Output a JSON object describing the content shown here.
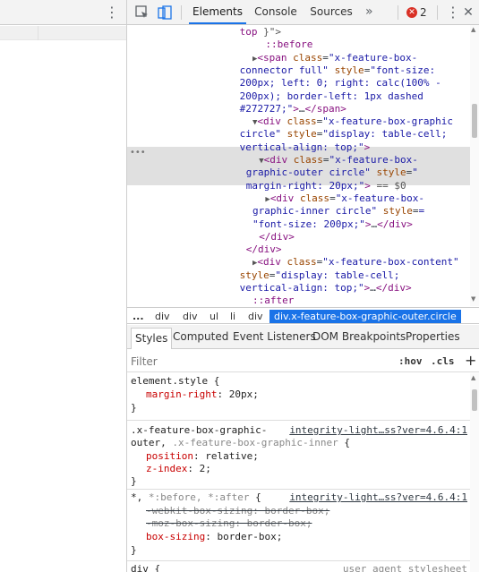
{
  "toolbar": {
    "tabs": [
      "Elements",
      "Console",
      "Sources"
    ],
    "more_tabs": "»",
    "error_count": "2",
    "kebab": "⋮",
    "close": "✕"
  },
  "left_pane": {
    "kebab": "⋮"
  },
  "tree": {
    "lines": [
      {
        "indent": 18,
        "html": "<span class='tag'>top</span><span class='cm'> }\"></span>"
      },
      {
        "indent": 22,
        "html": "<span class='pe'>::before</span>"
      },
      {
        "indent": 20,
        "html": "<span class='tri'>▶</span><span class='tag'>&lt;span</span> <span class='an'>class</span>=<span class='av'>\"x-feature-box-</span>"
      },
      {
        "indent": 18,
        "html": "<span class='av'>connector full\"</span> <span class='an'>style</span>=<span class='av'>\"font-size:</span>"
      },
      {
        "indent": 18,
        "html": "<span class='av'>200px; left: 0; right: calc(100% -</span>"
      },
      {
        "indent": 18,
        "html": "<span class='av'>200px); border-left: 1px dashed</span>"
      },
      {
        "indent": 18,
        "html": "<span class='av'>#272727;\"</span><span class='tag'>&gt;</span>…<span class='tag'>&lt;/span&gt;</span>"
      },
      {
        "indent": 20,
        "html": "<span class='tri'>▼</span><span class='tag'>&lt;div</span> <span class='an'>class</span>=<span class='av'>\"x-feature-box-graphic</span>"
      },
      {
        "indent": 18,
        "html": "<span class='av'>circle\"</span> <span class='an'>style</span>=<span class='av'>\"display: table-cell;</span>"
      },
      {
        "indent": 18,
        "html": "<span class='av'>vertical-align: top;\"</span><span class='tag'>&gt;</span>"
      },
      {
        "indent": 21,
        "html": "<span class='tri'>▼</span><span class='tag'>&lt;div</span> <span class='an'>class</span>=<span class='av'>\"x-feature-box-</span>"
      },
      {
        "indent": 19,
        "html": "<span class='av'>graphic-outer circle\"</span> <span class='an'>style</span>=<span class='av'>\"</span>"
      },
      {
        "indent": 19,
        "html": "<span class='av'>margin-right: 20px;\"</span><span class='tag'>&gt;</span> <span class='cm'>== $0</span>"
      },
      {
        "indent": 22,
        "html": "<span class='tri'>▶</span><span class='tag'>&lt;div</span> <span class='an'>class</span>=<span class='av'>\"x-feature-box-</span>"
      },
      {
        "indent": 20,
        "html": "<span class='av'>graphic-inner circle\"</span> <span class='an'>style</span>=<span class='av'>=</span>"
      },
      {
        "indent": 20,
        "html": "<span class='av'>\"font-size: 200px;\"</span><span class='tag'>&gt;</span>…<span class='tag'>&lt;/div&gt;</span>"
      },
      {
        "indent": 21,
        "html": "<span class='tag'>&lt;/div&gt;</span>"
      },
      {
        "indent": 19,
        "html": "<span class='tag'>&lt;/div&gt;</span>"
      },
      {
        "indent": 20,
        "html": "<span class='tri'>▶</span><span class='tag'>&lt;div</span> <span class='an'>class</span>=<span class='av'>\"x-feature-box-content\"</span>"
      },
      {
        "indent": 18,
        "html": "<span class='an'>style</span>=<span class='av'>\"display: table-cell;</span>"
      },
      {
        "indent": 18,
        "html": "<span class='av'>vertical-align: top;\"</span><span class='tag'>&gt;</span>…<span class='tag'>&lt;/div&gt;</span>"
      },
      {
        "indent": 20,
        "html": "<span class='pe'>::after</span>"
      },
      {
        "indent": 18,
        "html": "<span class='tag'>&lt;/div&gt;</span>"
      }
    ],
    "selected_dots": "•••"
  },
  "breadcrumbs": {
    "items": [
      "...",
      "div",
      "div",
      "ul",
      "li",
      "div"
    ],
    "active": "div.x-feature-box-graphic-outer.circle"
  },
  "styles_tabs": [
    "Styles",
    "Computed",
    "Event Listeners",
    "DOM Breakpoints",
    "Properties"
  ],
  "filter": {
    "placeholder": "Filter",
    "hov": ":hov",
    "cls": ".cls",
    "add": "+"
  },
  "rules": {
    "r1": {
      "selector": "element.style {",
      "decl_name": "margin-right",
      "decl_value": ": 20px;",
      "close": "}"
    },
    "r2": {
      "selector_a": ".x-feature-box-graphic-",
      "selector_b": "outer, ",
      "selector_b_dim": ".x-feature-box-graphic-inner",
      "selector_b_end": " {",
      "source": "integrity-light…ss?ver=4.6.4:1",
      "d1_name": "position",
      "d1_value": ": relative;",
      "d2_name": "z-index",
      "d2_value": ": 2;",
      "close": "}"
    },
    "r3": {
      "selector_a": "*, ",
      "selector_dim": "*:before, *:after",
      "selector_end": " {",
      "source": "integrity-light…ss?ver=4.6.4:1",
      "d1_name": "-webkit-box-sizing",
      "d1_value": ": border-box;",
      "d2_name": "-moz-box-sizing",
      "d2_value": ": border-box;",
      "d3_name": "box-sizing",
      "d3_value": ": border-box;",
      "close": "}"
    },
    "r4": {
      "selector": "div {",
      "source": "user agent stylesheet"
    }
  }
}
